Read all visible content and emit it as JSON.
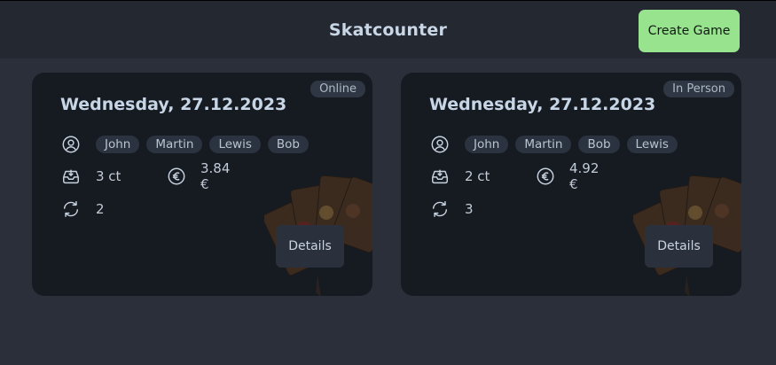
{
  "header": {
    "title": "Skatcounter",
    "create_label": "Create Game"
  },
  "games": [
    {
      "date": "Wednesday, 27.12.2023",
      "mode": "Online",
      "players": [
        "John",
        "Martin",
        "Lewis",
        "Bob"
      ],
      "cents": "3 ct",
      "total": "3.84 €",
      "rounds": "2",
      "details_label": "Details"
    },
    {
      "date": "Wednesday, 27.12.2023",
      "mode": "In Person",
      "players": [
        "John",
        "Martin",
        "Bob",
        "Lewis"
      ],
      "cents": "2 ct",
      "total": "4.92 €",
      "rounds": "3",
      "details_label": "Details"
    }
  ],
  "icons": {
    "players": "user-circle-icon",
    "cents": "inbox-tray-icon",
    "total": "euro-icon",
    "rounds": "refresh-icon"
  },
  "colors": {
    "accent": "#98e38e",
    "background": "#2a2f3a",
    "card": "#161a21"
  }
}
